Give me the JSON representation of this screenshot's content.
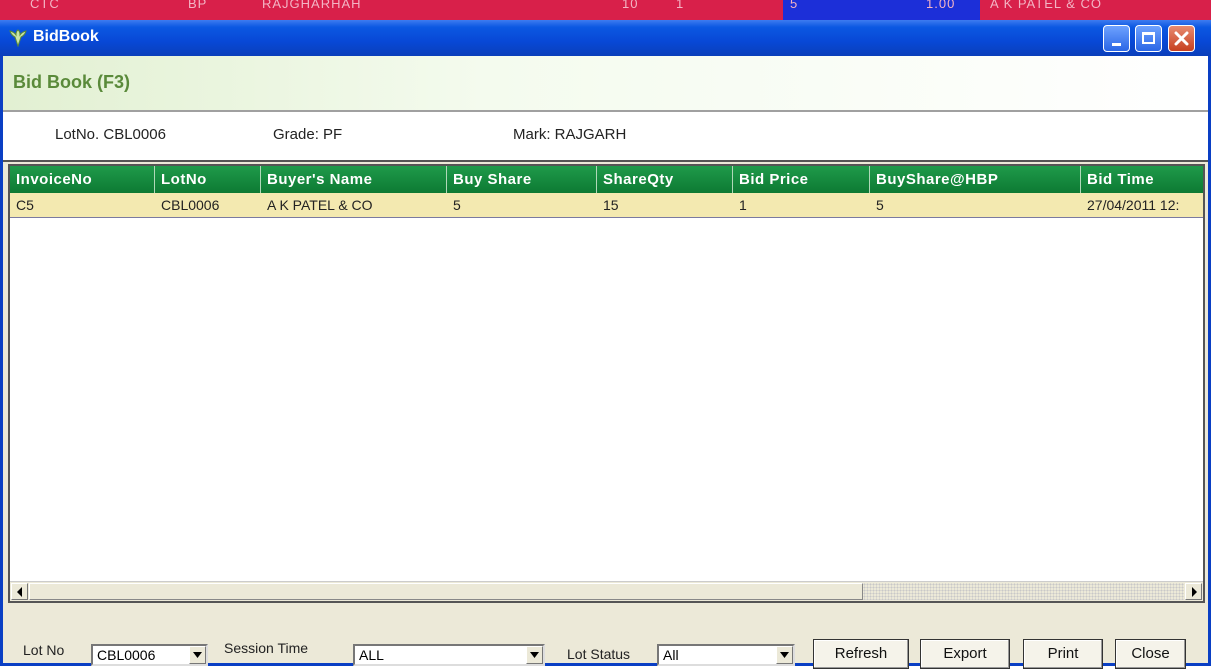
{
  "background_row": {
    "cells": [
      "CTC",
      "BP",
      "RAJGHARHAH",
      "10",
      "1",
      "5",
      "1.00",
      "A K PATEL & CO"
    ]
  },
  "window": {
    "title": "BidBook",
    "min_glyph": "_",
    "max_glyph": "□",
    "close_glyph": "×"
  },
  "header": {
    "title": "Bid Book (F3)"
  },
  "info": {
    "lot": "LotNo. CBL0006",
    "grade": "Grade: PF",
    "mark": "Mark: RAJGARH"
  },
  "grid": {
    "columns": [
      "InvoiceNo",
      "LotNo",
      "Buyer's Name",
      "Buy Share",
      "ShareQty",
      "Bid Price",
      "BuyShare@HBP",
      "Bid Time"
    ],
    "rows": [
      [
        "C5",
        "CBL0006",
        "A K PATEL & CO",
        "5",
        "15",
        "1",
        "5",
        "27/04/2011 12:"
      ]
    ]
  },
  "footer": {
    "lot_no_label": "Lot No",
    "lot_no_value": "CBL0006",
    "session_label": "Session Time",
    "session_value": "ALL",
    "status_label": "Lot Status",
    "status_value": "All",
    "refresh": "Refresh",
    "export": "Export",
    "print": "Print",
    "close": "Close"
  },
  "colors": {
    "grid_header": "#0d7a33",
    "selected_row": "#f3e9b0",
    "title_bar": "#0848d6"
  },
  "icons": [
    "app-logo-icon",
    "minimize-icon",
    "maximize-icon",
    "close-icon",
    "scroll-left-icon",
    "scroll-right-icon",
    "dropdown-arrow-icon"
  ]
}
